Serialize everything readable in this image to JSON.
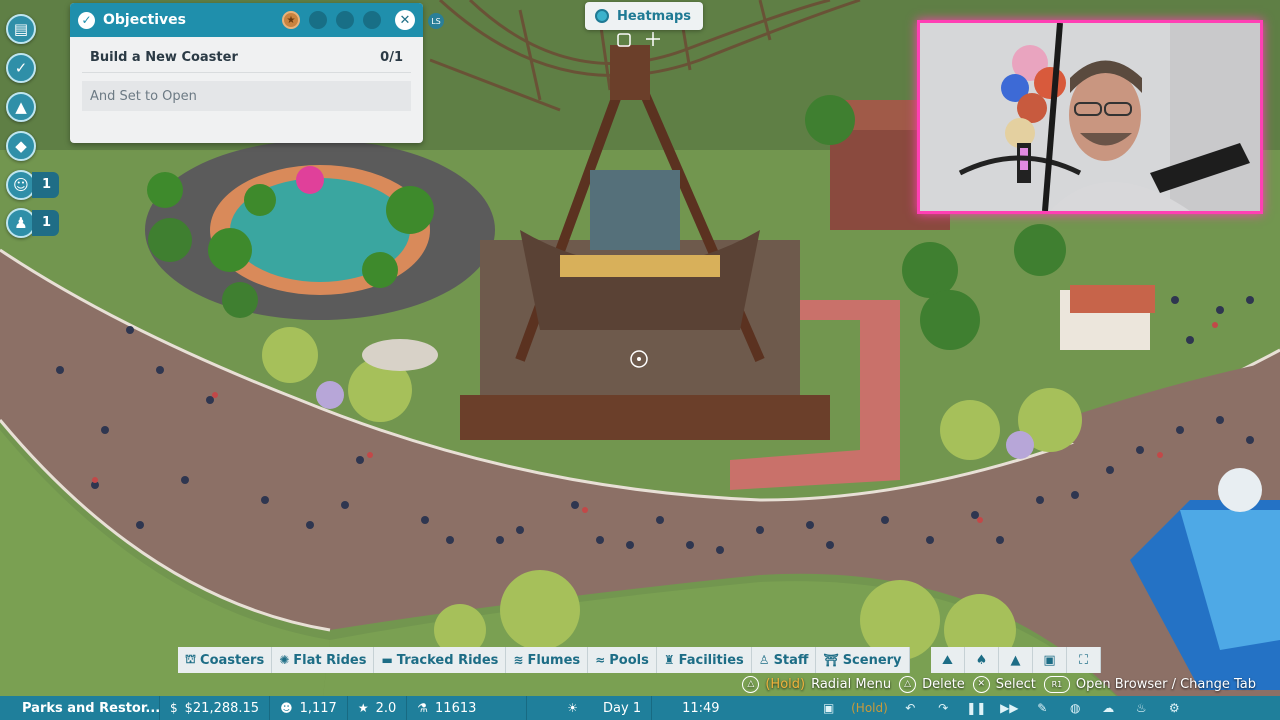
{
  "objectives": {
    "title": "Objectives",
    "goal": "Build a New Coaster",
    "progress": "0/1",
    "subgoal": "And Set to Open",
    "side_badge": "LS"
  },
  "left_rail": {
    "guests_alert_count": "1",
    "staff_alert_count": "1"
  },
  "heatmaps": {
    "label": "Heatmaps"
  },
  "build_categories": [
    {
      "label": "Coasters",
      "icon": "coaster-icon"
    },
    {
      "label": "Flat Rides",
      "icon": "flat-ride-icon"
    },
    {
      "label": "Tracked Rides",
      "icon": "tracked-ride-icon"
    },
    {
      "label": "Flumes",
      "icon": "flume-icon"
    },
    {
      "label": "Pools",
      "icon": "pool-icon"
    },
    {
      "label": "Facilities",
      "icon": "facilities-icon"
    },
    {
      "label": "Staff",
      "icon": "staff-icon"
    },
    {
      "label": "Scenery",
      "icon": "scenery-icon"
    }
  ],
  "hints": {
    "radial_hold": "(Hold)",
    "radial_menu": "Radial Menu",
    "delete": "Delete",
    "select": "Select",
    "browser_button": "R1",
    "open_browser": "Open Browser / Change Tab"
  },
  "status": {
    "park_name": "Parks and Restor...",
    "money": "$21,288.15",
    "guests": "1,117",
    "rating": "2.0",
    "research": "11613",
    "day": "Day 1",
    "time": "11:49",
    "hold": "(Hold)"
  },
  "colors": {
    "accent": "#1f8fac",
    "status_bar": "#1f7f9b",
    "webcam_frame": "#ff3fb4",
    "hold_text": "#f0b23c"
  }
}
